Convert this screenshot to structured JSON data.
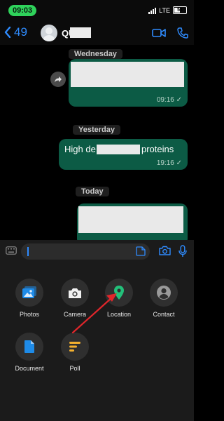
{
  "status_bar": {
    "time": "09:03",
    "network": "LTE",
    "battery": "53"
  },
  "header": {
    "back_count": "49",
    "contact_name": "QU"
  },
  "chat": {
    "days": [
      "Wednesday",
      "Yesterday",
      "Today"
    ],
    "messages": [
      {
        "text": "",
        "time": "09:16 ✓"
      },
      {
        "text_start": "High de",
        "text_end": "proteins",
        "time": "19:16 ✓"
      },
      {
        "text": "",
        "time": ""
      }
    ]
  },
  "attach_menu": {
    "items": [
      {
        "label": "Photos",
        "icon": "photos-icon"
      },
      {
        "label": "Camera",
        "icon": "camera-icon"
      },
      {
        "label": "Location",
        "icon": "location-icon"
      },
      {
        "label": "Contact",
        "icon": "contact-icon"
      },
      {
        "label": "Document",
        "icon": "document-icon"
      },
      {
        "label": "Poll",
        "icon": "poll-icon"
      }
    ]
  },
  "colors": {
    "accent": "#2f8cff",
    "bubble": "#0c5b45",
    "time_pill": "#2fd35b",
    "location": "#23c07a",
    "poll": "#f4b12f",
    "document": "#1e8be8",
    "arrow": "#e0262b"
  }
}
